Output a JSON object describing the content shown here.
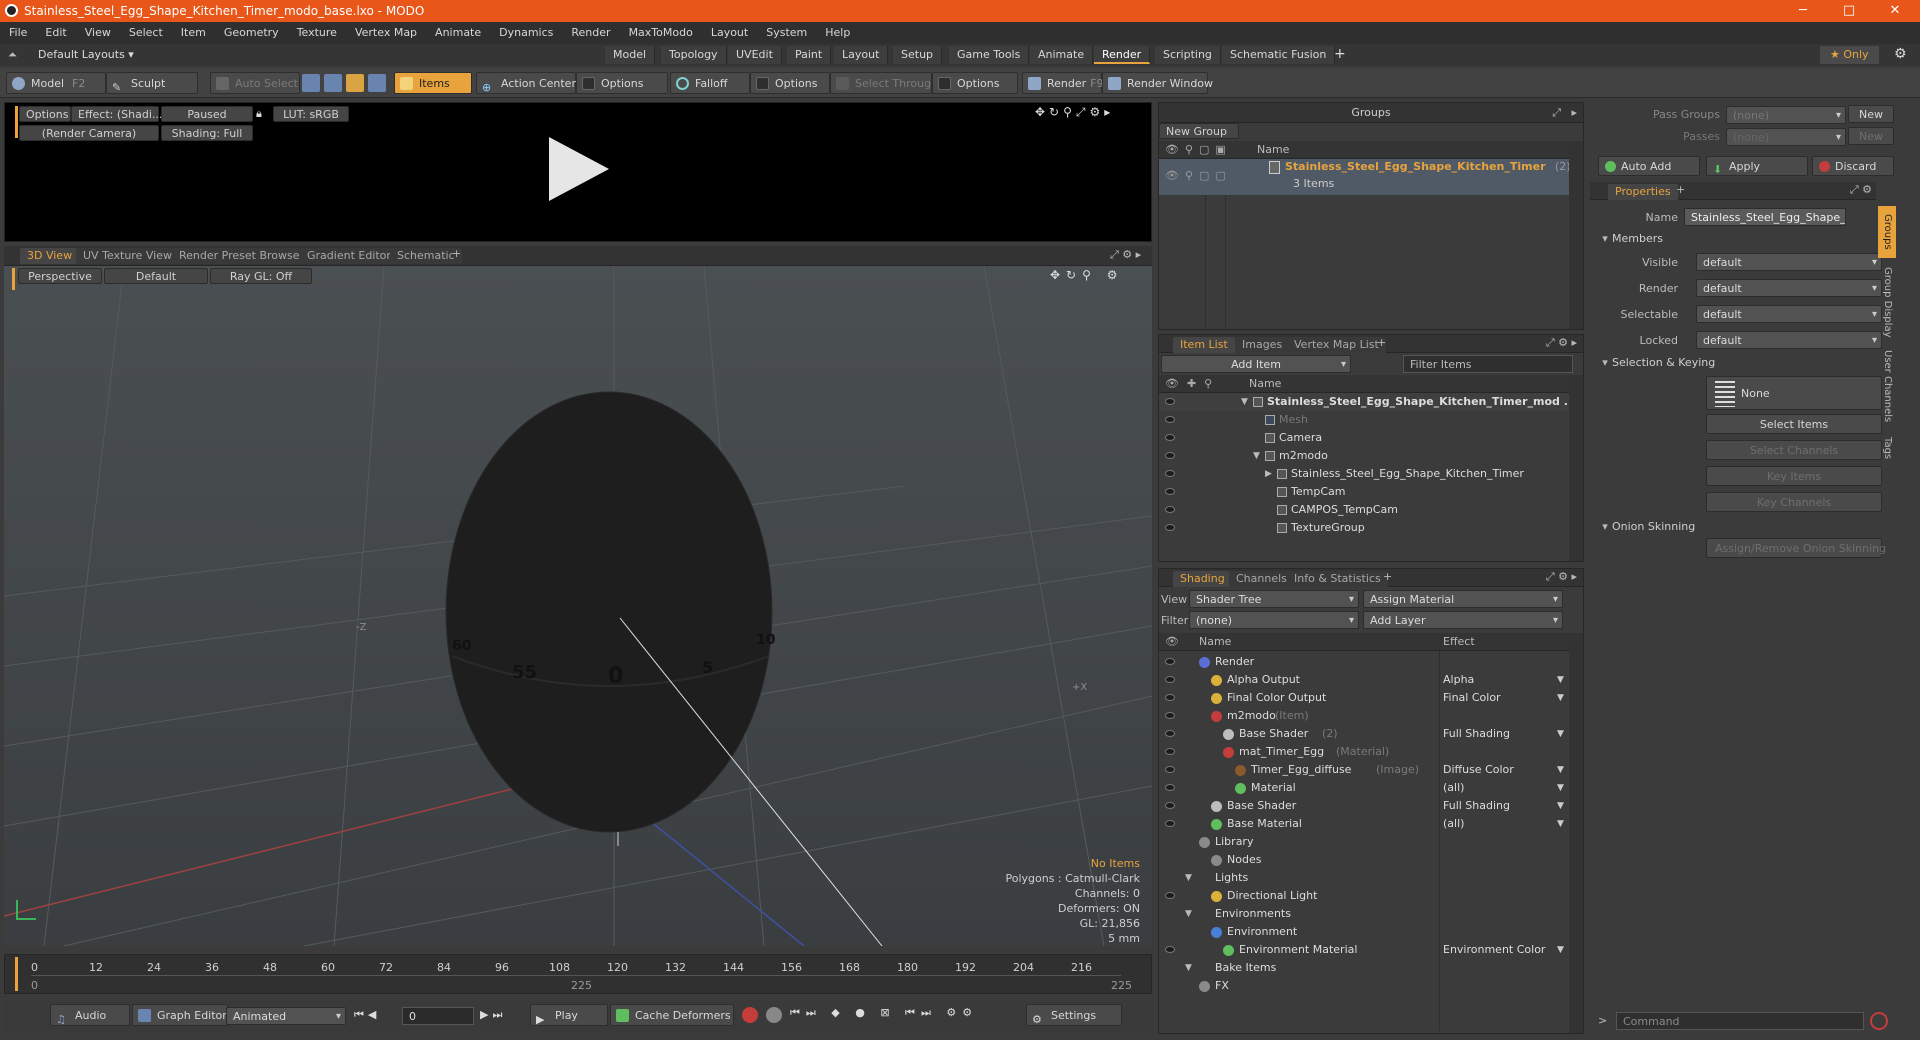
{
  "window": {
    "title": "Stainless_Steel_Egg_Shape_Kitchen_Timer_modo_base.lxo - MODO",
    "minimize": "─",
    "maximize": "□",
    "close": "✕"
  },
  "menu": [
    "File",
    "Edit",
    "View",
    "Select",
    "Item",
    "Geometry",
    "Texture",
    "Vertex Map",
    "Animate",
    "Dynamics",
    "Render",
    "MaxToModo",
    "Layout",
    "System",
    "Help"
  ],
  "layout": {
    "default_layouts": "Default Layouts ▾",
    "tabs": [
      "Model",
      "Topology",
      "UVEdit",
      "Paint",
      "Layout",
      "Setup",
      "Game Tools",
      "Animate",
      "Render",
      "Scripting",
      "Schematic Fusion"
    ],
    "active_tab": "Render",
    "plus": "+",
    "only": "★  Only",
    "gear": "⚙"
  },
  "toolbar": {
    "model": "Model",
    "model_key": "F2",
    "sculpt": "Sculpt",
    "auto_select": "Auto Select",
    "items": "Items",
    "action_center": "Action Center",
    "options1": "Options",
    "falloff": "Falloff",
    "options2": "Options",
    "select_through": "Select Through",
    "options3": "Options",
    "render": "Render",
    "render_key": "F9",
    "render_window": "Render Window"
  },
  "preview": {
    "options": "Options",
    "effect": "Effect: (Shadi...",
    "paused": "Paused",
    "lut": "LUT: sRGB",
    "camera": "(Render Camera)",
    "shading": "Shading: Full"
  },
  "viewport": {
    "tabs": [
      "3D View",
      "UV Texture View",
      "Render Preset Browser",
      "Gradient Editor",
      "Schematic"
    ],
    "plus": "+",
    "perspective": "Perspective",
    "default": "Default",
    "raygl": "Ray GL: Off",
    "axis_z": "-Z",
    "axis_x": "+X",
    "egg_labels": [
      "60",
      "55",
      "0",
      "5",
      "10"
    ],
    "stats": {
      "no_items": "No Items",
      "polygons": "Polygons : Catmull-Clark",
      "channels": "Channels: 0",
      "deformers": "Deformers: ON",
      "gl": "GL: 21,856",
      "scale": "5 mm"
    }
  },
  "timeline": {
    "ticks": [
      "0",
      "12",
      "24",
      "36",
      "48",
      "60",
      "72",
      "84",
      "96",
      "108",
      "120",
      "132",
      "144",
      "156",
      "168",
      "180",
      "192",
      "204",
      "216"
    ],
    "start": "0",
    "mid": "225",
    "end": "225"
  },
  "bottombar": {
    "audio": "Audio",
    "graph_editor": "Graph Editor",
    "animated": "Animated",
    "frame": "0",
    "play": "Play",
    "cache_deformers": "Cache Deformers",
    "settings": "Settings"
  },
  "groups": {
    "title": "Groups",
    "new_group": "New Group",
    "col_name": "Name",
    "item_name": "Stainless_Steel_Egg_Shape_Kitchen_Timer",
    "item_count": "(2)",
    "item_sub": "3 Items"
  },
  "itemlist": {
    "tabs": [
      "Item List",
      "Images",
      "Vertex Map List"
    ],
    "plus": "+",
    "add_item": "Add Item",
    "filter": "Filter Items",
    "col_name": "Name",
    "items": [
      {
        "label": "Stainless_Steel_Egg_Shape_Kitchen_Timer_mod ...",
        "indent": 0,
        "arrow": "▼",
        "bold": true,
        "dim": false
      },
      {
        "label": "Mesh",
        "indent": 1,
        "arrow": "",
        "bold": false,
        "dim": true
      },
      {
        "label": "Camera",
        "indent": 1,
        "arrow": "",
        "bold": false,
        "dim": false
      },
      {
        "label": "m2modo",
        "indent": 1,
        "arrow": "▼",
        "bold": false,
        "dim": false
      },
      {
        "label": "Stainless_Steel_Egg_Shape_Kitchen_Timer",
        "indent": 2,
        "arrow": "▶",
        "bold": false,
        "dim": false
      },
      {
        "label": "TempCam",
        "indent": 2,
        "arrow": "",
        "bold": false,
        "dim": false
      },
      {
        "label": "CAMPOS_TempCam",
        "indent": 2,
        "arrow": "",
        "bold": false,
        "dim": false
      },
      {
        "label": "TextureGroup",
        "indent": 2,
        "arrow": "",
        "bold": false,
        "dim": false
      }
    ]
  },
  "shading": {
    "tabs": [
      "Shading",
      "Channels",
      "Info & Statistics"
    ],
    "plus": "+",
    "view_label": "View",
    "view_value": "Shader Tree",
    "assign_material": "Assign Material",
    "filter_label": "Filter",
    "filter_value": "(none)",
    "add_layer": "Add Layer",
    "col_name": "Name",
    "col_effect": "Effect",
    "rows": [
      {
        "name": "Render",
        "tag": "",
        "effect": "",
        "indent": 0,
        "color": "#5a6fd6"
      },
      {
        "name": "Alpha Output",
        "tag": "",
        "effect": "Alpha",
        "indent": 1,
        "color": "#d9b13a"
      },
      {
        "name": "Final Color Output",
        "tag": "",
        "effect": "Final Color",
        "indent": 1,
        "color": "#d9b13a"
      },
      {
        "name": "m2modo",
        "tag": "(Item)",
        "effect": "",
        "indent": 1,
        "color": "#c43c3c"
      },
      {
        "name": "Base Shader",
        "tag": "(2)",
        "effect": "Full Shading",
        "indent": 2,
        "color": "#bdbdbd"
      },
      {
        "name": "mat_Timer_Egg",
        "tag": "(Material)",
        "effect": "",
        "indent": 2,
        "color": "#c43c3c"
      },
      {
        "name": "Timer_Egg_diffuse",
        "tag": "(Image)",
        "effect": "Diffuse Color",
        "indent": 3,
        "color": "#8a5a2a"
      },
      {
        "name": "Material",
        "tag": "",
        "effect": "(all)",
        "indent": 3,
        "color": "#5fbf5f"
      },
      {
        "name": "Base Shader",
        "tag": "",
        "effect": "Full Shading",
        "indent": 1,
        "color": "#bdbdbd"
      },
      {
        "name": "Base Material",
        "tag": "",
        "effect": "(all)",
        "indent": 1,
        "color": "#5fbf5f"
      },
      {
        "name": "Library",
        "tag": "",
        "effect": "",
        "indent": 0,
        "color": "#8a8a8a"
      },
      {
        "name": "Nodes",
        "tag": "",
        "effect": "",
        "indent": 1,
        "color": "#8a8a8a"
      },
      {
        "name": "Lights",
        "tag": "",
        "effect": "",
        "indent": 0,
        "color": ""
      },
      {
        "name": "Directional Light",
        "tag": "",
        "effect": "",
        "indent": 1,
        "color": "#d9b13a"
      },
      {
        "name": "Environments",
        "tag": "",
        "effect": "",
        "indent": 0,
        "color": ""
      },
      {
        "name": "Environment",
        "tag": "",
        "effect": "",
        "indent": 1,
        "color": "#4a7fd6"
      },
      {
        "name": "Environment Material",
        "tag": "",
        "effect": "Environment Color",
        "indent": 2,
        "color": "#5fbf5f"
      },
      {
        "name": "Bake Items",
        "tag": "",
        "effect": "",
        "indent": 0,
        "color": ""
      },
      {
        "name": "FX",
        "tag": "",
        "effect": "",
        "indent": 0,
        "color": "#8a8a8a"
      }
    ]
  },
  "props": {
    "pass_groups": "Pass Groups",
    "passes": "Passes",
    "none": "(none)",
    "new": "New",
    "auto_add": "Auto Add",
    "apply": "Apply",
    "discard": "Discard",
    "tab": "Properties",
    "plus": "+",
    "name_label": "Name",
    "name_value": "Stainless_Steel_Egg_Shape_Kitchen",
    "members": "Members",
    "visible": "Visible",
    "render": "Render",
    "selectable": "Selectable",
    "locked": "Locked",
    "default": "default",
    "selection_keying": "Selection & Keying",
    "none_btn": "None",
    "select_items": "Select Items",
    "select_channels": "Select Channels",
    "key_items": "Key Items",
    "key_channels": "Key Channels",
    "onion": "Onion Skinning",
    "assign_onion": "Assign/Remove Onion Skinning",
    "side_tabs": [
      "Groups",
      "Group Display",
      "User Channels",
      "Tags"
    ],
    "command": "Command"
  },
  "colors": {
    "accent": "#e8a33d",
    "titlebar": "#e8561a"
  }
}
